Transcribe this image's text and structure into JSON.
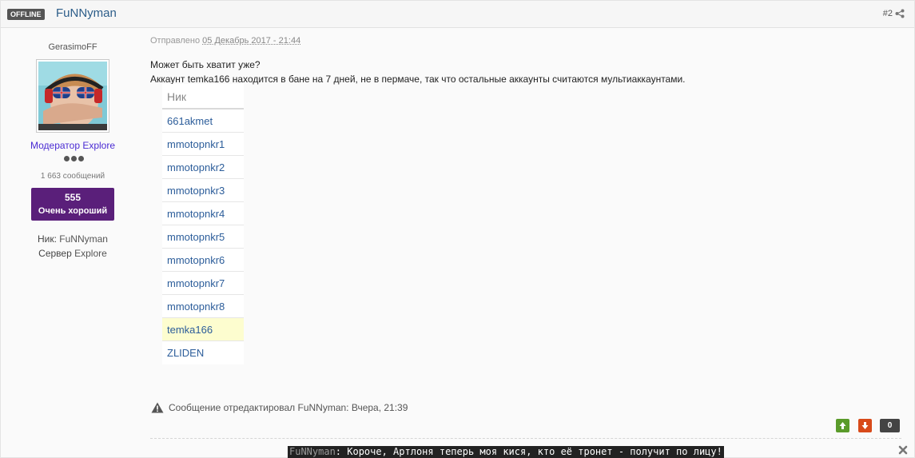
{
  "header": {
    "status_badge": "OFFLINE",
    "author_name": "FuNNyman",
    "post_number": "#2",
    "share_icon": "share-icon"
  },
  "author_panel": {
    "user_title": "GerasimoFF",
    "group_name": "Модератор Explore",
    "post_count": "1 663 сообщений",
    "reputation_value": "555",
    "reputation_label": "Очень хороший",
    "nick_label": "Ник:",
    "nick_value": "FuNNyman",
    "server_label": "Сервер",
    "server_value": "Explore",
    "group_color": "#4a2bd3",
    "reputation_color": "#5a1f7a"
  },
  "post": {
    "posted_prefix": "Отправлено",
    "posted_date": "05 Декабрь 2017 - 21:44",
    "line1": "Может быть хватит уже?",
    "line2": "Аккаунт temka166 находится в бане на 7 дней, не в пермаче, так что остальные аккаунты считаются мультиаккаунтами.",
    "table": {
      "header": "Ник",
      "rows": [
        "661akmet",
        "mmotopnkr1",
        "mmotopnkr2",
        "mmotopnkr3",
        "mmotopnkr4",
        "mmotopnkr5",
        "mmotopnkr6",
        "mmotopnkr7",
        "mmotopnkr8",
        "temka166",
        "ZLIDEN"
      ],
      "highlighted_row": "temka166"
    },
    "edit_note": "Сообщение отредактировал FuNNyman: Вчера, 21:39"
  },
  "voting": {
    "up_icon": "arrow-up-icon",
    "down_icon": "arrow-down-icon",
    "count": "0",
    "up_color": "#5a9b2a",
    "down_color": "#d84a1a"
  },
  "shoutbox": {
    "author": "FuNNyman",
    "separator": ":",
    "text": " Короче, Артлоня теперь моя кися, кто её тронет - получит по лицу!",
    "close_icon": "close-icon"
  }
}
